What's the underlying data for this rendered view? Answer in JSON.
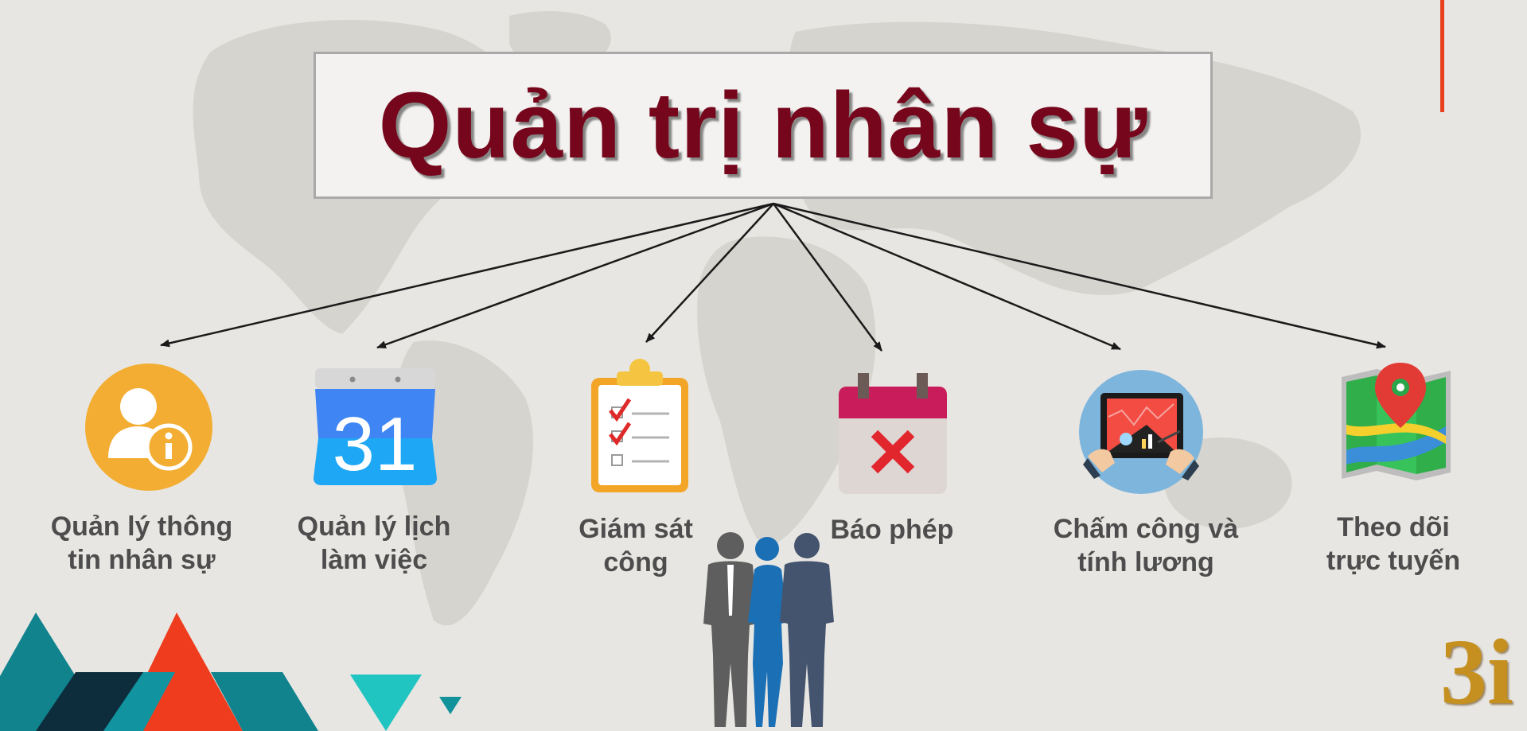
{
  "title": "Quản trị nhân sự",
  "logo": "3i",
  "modules": [
    {
      "line1": "Quản lý thông",
      "line2": "tin nhân sự",
      "icon": "user-info-icon"
    },
    {
      "line1": "Quản lý lịch",
      "line2": "làm việc",
      "icon": "calendar-icon",
      "icon_text": "31"
    },
    {
      "line1": "Giám sát",
      "line2": "công",
      "icon": "checklist-icon"
    },
    {
      "line1": "Báo phép",
      "line2": "",
      "icon": "leave-calendar-icon"
    },
    {
      "line1": "Chấm công và",
      "line2": "tính lương",
      "icon": "tablet-payroll-icon"
    },
    {
      "line1": "Theo dõi",
      "line2": "trực tuyến",
      "icon": "map-pin-icon"
    }
  ],
  "colors": {
    "title": "#76061c",
    "label": "#4d4d4d",
    "accent": "#e8401c",
    "logo": "#c5901f",
    "teal": "#0f8a93",
    "navy": "#0e2a3a"
  }
}
